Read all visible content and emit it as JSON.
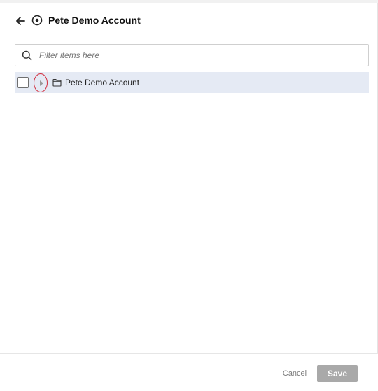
{
  "header": {
    "title": "Pete Demo Account",
    "back_icon": "arrow-left-icon",
    "account_icon": "target-icon"
  },
  "search": {
    "placeholder": "Filter items here",
    "value": "",
    "icon": "search-icon"
  },
  "tree": {
    "items": [
      {
        "label": "Pete Demo Account",
        "checked": false,
        "expanded": false,
        "icon": "folder-icon"
      }
    ]
  },
  "footer": {
    "cancel_label": "Cancel",
    "save_label": "Save"
  },
  "colors": {
    "selected_row": "#e5eaf4",
    "save_disabled": "#a9a9a9",
    "highlight_ring": "#d22b3a"
  }
}
